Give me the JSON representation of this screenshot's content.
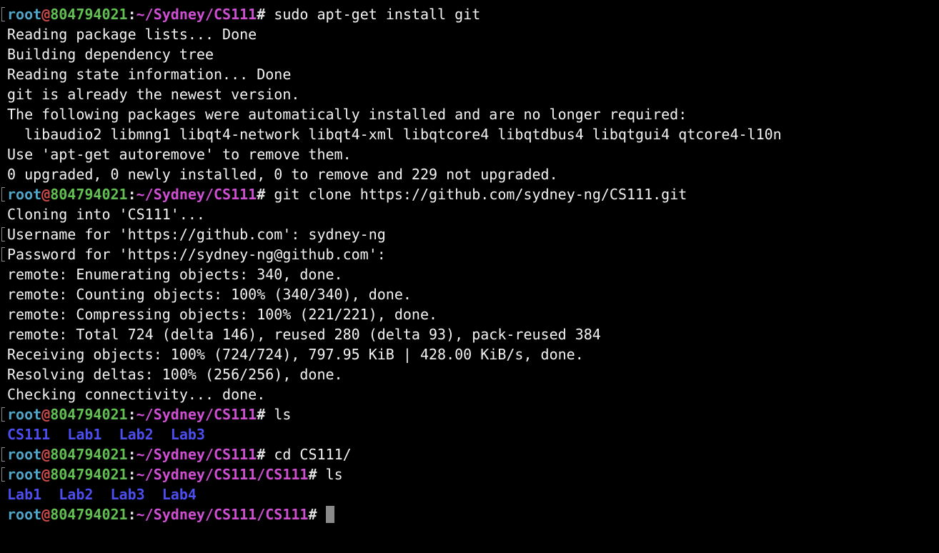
{
  "prompt": {
    "user": "root",
    "at": "@",
    "host": "804794021",
    "colon": ":",
    "hash": "#"
  },
  "lines": [
    {
      "type": "prompt",
      "path": "~/Sydney/CS111",
      "command": "sudo apt-get install git"
    },
    {
      "type": "output",
      "text": "Reading package lists... Done"
    },
    {
      "type": "output",
      "text": "Building dependency tree"
    },
    {
      "type": "output",
      "text": "Reading state information... Done"
    },
    {
      "type": "output",
      "text": "git is already the newest version."
    },
    {
      "type": "output",
      "text": "The following packages were automatically installed and are no longer required:"
    },
    {
      "type": "output",
      "text": "  libaudio2 libmng1 libqt4-network libqt4-xml libqtcore4 libqtdbus4 libqtgui4 qtcore4-l10n"
    },
    {
      "type": "output",
      "text": "Use 'apt-get autoremove' to remove them."
    },
    {
      "type": "output",
      "text": "0 upgraded, 0 newly installed, 0 to remove and 229 not upgraded."
    },
    {
      "type": "prompt",
      "path": "~/Sydney/CS111",
      "command": "git clone https://github.com/sydney-ng/CS111.git"
    },
    {
      "type": "output",
      "text": "Cloning into 'CS111'..."
    },
    {
      "type": "output",
      "text": "Username for 'https://github.com': sydney-ng",
      "marked": true
    },
    {
      "type": "output",
      "text": "Password for 'https://sydney-ng@github.com':",
      "marked": true
    },
    {
      "type": "output",
      "text": "remote: Enumerating objects: 340, done."
    },
    {
      "type": "output",
      "text": "remote: Counting objects: 100% (340/340), done."
    },
    {
      "type": "output",
      "text": "remote: Compressing objects: 100% (221/221), done."
    },
    {
      "type": "output",
      "text": "remote: Total 724 (delta 146), reused 280 (delta 93), pack-reused 384"
    },
    {
      "type": "output",
      "text": "Receiving objects: 100% (724/724), 797.95 KiB | 428.00 KiB/s, done."
    },
    {
      "type": "output",
      "text": "Resolving deltas: 100% (256/256), done."
    },
    {
      "type": "output",
      "text": "Checking connectivity... done."
    },
    {
      "type": "prompt",
      "path": "~/Sydney/CS111",
      "command": "ls"
    },
    {
      "type": "dirs",
      "text": "CS111  Lab1  Lab2  Lab3"
    },
    {
      "type": "prompt",
      "path": "~/Sydney/CS111",
      "command": "cd CS111/"
    },
    {
      "type": "prompt",
      "path": "~/Sydney/CS111/CS111",
      "command": "ls"
    },
    {
      "type": "dirs",
      "text": "Lab1  Lab2  Lab3  Lab4"
    },
    {
      "type": "prompt",
      "path": "~/Sydney/CS111/CS111",
      "command": "",
      "cursor": true,
      "unmarked": true
    }
  ],
  "colors": {
    "background": "#000000",
    "user": "#4fa6c8",
    "host": "#62c052",
    "path": "#cf4fd2",
    "directory": "#4c4ef0",
    "text": "#f2f2f2"
  }
}
